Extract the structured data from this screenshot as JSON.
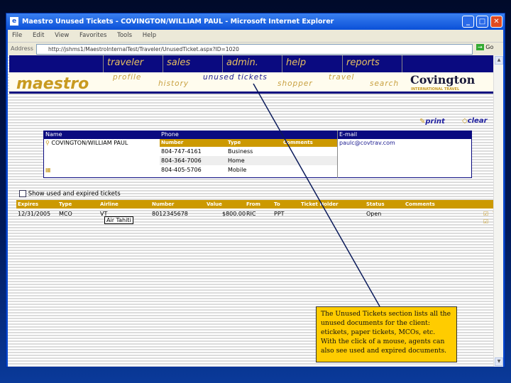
{
  "window": {
    "title": "Maestro Unused Tickets - COVINGTON/WILLIAM PAUL - Microsoft Internet Explorer",
    "menu": [
      "File",
      "Edit",
      "View",
      "Favorites",
      "Tools",
      "Help"
    ],
    "address_label": "Address",
    "url": "http://jshms1/MaestroInternalTest/Traveler/UnusedTicket.aspx?ID=1020",
    "go": "Go"
  },
  "nav": {
    "top": [
      "traveler",
      "sales",
      "admin.",
      "help",
      "reports"
    ],
    "sub": [
      "profile",
      "history",
      "unused tickets",
      "shopper",
      "travel",
      "search"
    ],
    "logo": "maestro",
    "brand": "Covington",
    "brand_sub": "INTERNATIONAL TRAVEL"
  },
  "tools": {
    "print": "print",
    "clear": "clear"
  },
  "contact": {
    "headers": {
      "name": "Name",
      "phone": "Phone",
      "email": "E-mail"
    },
    "phone_headers": [
      "Number",
      "Type",
      "Comments"
    ],
    "name": "COVINGTON/WILLIAM PAUL",
    "email": "paulc@covtrav.com",
    "phones": [
      {
        "number": "804-747-4161",
        "type": "Business"
      },
      {
        "number": "804-364-7006",
        "type": "Home"
      },
      {
        "number": "804-405-5706",
        "type": "Mobile"
      }
    ]
  },
  "show_used": "Show used and expired tickets",
  "tickets": {
    "headers": [
      "Expires",
      "Type",
      "Airline",
      "Number",
      "Value",
      "From",
      "To",
      "Ticket Holder",
      "Status",
      "Comments"
    ],
    "rows": [
      {
        "expires": "12/31/2005",
        "type": "MCO",
        "airline": "VT",
        "number": "8012345678",
        "value": "$800.00",
        "from": "RIC",
        "to": "PPT",
        "holder": "",
        "status": "Open",
        "comments": ""
      }
    ],
    "tooltip": "Air Tahiti"
  },
  "callout": "The Unused Tickets section lists all the unused documents for the client: etickets, paper tickets, MCOs, etc. With the click of a mouse, agents can also see used and expired documents."
}
